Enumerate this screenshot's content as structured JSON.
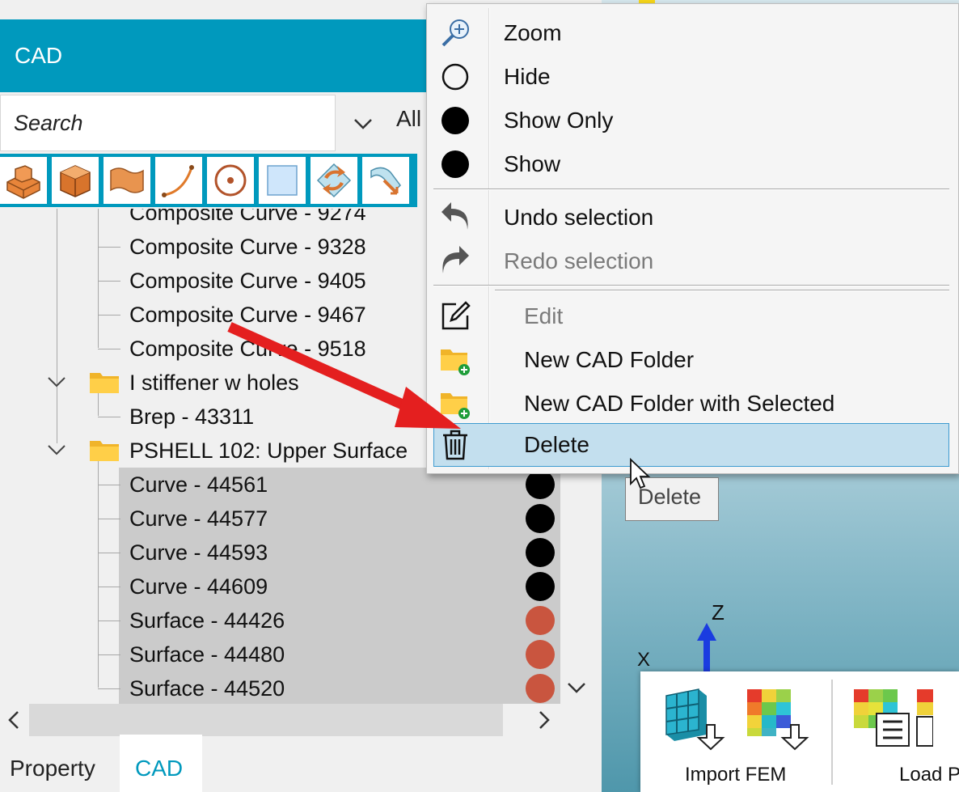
{
  "panel": {
    "title": "CAD",
    "search": {
      "placeholder": "Search",
      "value": ""
    },
    "filter": {
      "selected": "All"
    },
    "toolbar": [
      {
        "name": "solid-extrude-icon"
      },
      {
        "name": "solid-box-icon"
      },
      {
        "name": "surface-icon"
      },
      {
        "name": "curve-icon"
      },
      {
        "name": "point-icon"
      },
      {
        "name": "plane-icon"
      },
      {
        "name": "refresh-shape-icon"
      },
      {
        "name": "sweep-icon"
      }
    ]
  },
  "tree": {
    "rows": [
      {
        "label": "Composite Curve - 9274"
      },
      {
        "label": "Composite Curve - 9328"
      },
      {
        "label": "Composite Curve - 9405"
      },
      {
        "label": "Composite Curve - 9467"
      },
      {
        "label": "Composite Curve - 9518"
      },
      {
        "label": "I stiffener w holes"
      },
      {
        "label": "Brep - 43311"
      },
      {
        "label": "PSHELL 102: Upper Surface"
      },
      {
        "label": "Curve - 44561",
        "color": "black"
      },
      {
        "label": "Curve - 44577",
        "color": "black"
      },
      {
        "label": "Curve - 44593",
        "color": "black"
      },
      {
        "label": "Curve - 44609",
        "color": "black"
      },
      {
        "label": "Surface - 44426",
        "color": "#c9553f"
      },
      {
        "label": "Surface - 44480",
        "color": "#c9553f"
      },
      {
        "label": "Surface - 44520",
        "color": "#c9553f"
      }
    ]
  },
  "bottom_tabs": [
    {
      "label": "Property"
    },
    {
      "label": "CAD",
      "active": true
    }
  ],
  "context_menu": {
    "items": [
      {
        "label": "Zoom",
        "icon": "zoom-in-icon"
      },
      {
        "label": "Hide",
        "icon": "empty-circle-icon"
      },
      {
        "label": "Show Only",
        "icon": "filled-circle-icon"
      },
      {
        "label": "Show",
        "icon": "filled-circle-icon"
      },
      {
        "label": "Undo selection",
        "icon": "undo-icon"
      },
      {
        "label": "Redo selection",
        "icon": "redo-icon",
        "disabled": true
      },
      {
        "label": "Edit",
        "icon": "edit-icon",
        "disabled": true
      },
      {
        "label": "New CAD Folder",
        "icon": "new-folder-icon"
      },
      {
        "label": "New CAD Folder with Selected",
        "icon": "new-folder-selected-icon"
      },
      {
        "label": "Delete",
        "icon": "trash-icon",
        "highlighted": true
      }
    ]
  },
  "tooltip": {
    "text": "Delete"
  },
  "viewport": {
    "axes": {
      "z": "Z",
      "x": "X"
    },
    "ribbon": {
      "import_fem": "Import FEM",
      "load": "Load P"
    }
  },
  "colors": {
    "accent": "#0099bd",
    "menu_highlight": "#c3dfee",
    "arrow": "#e41f1f"
  }
}
